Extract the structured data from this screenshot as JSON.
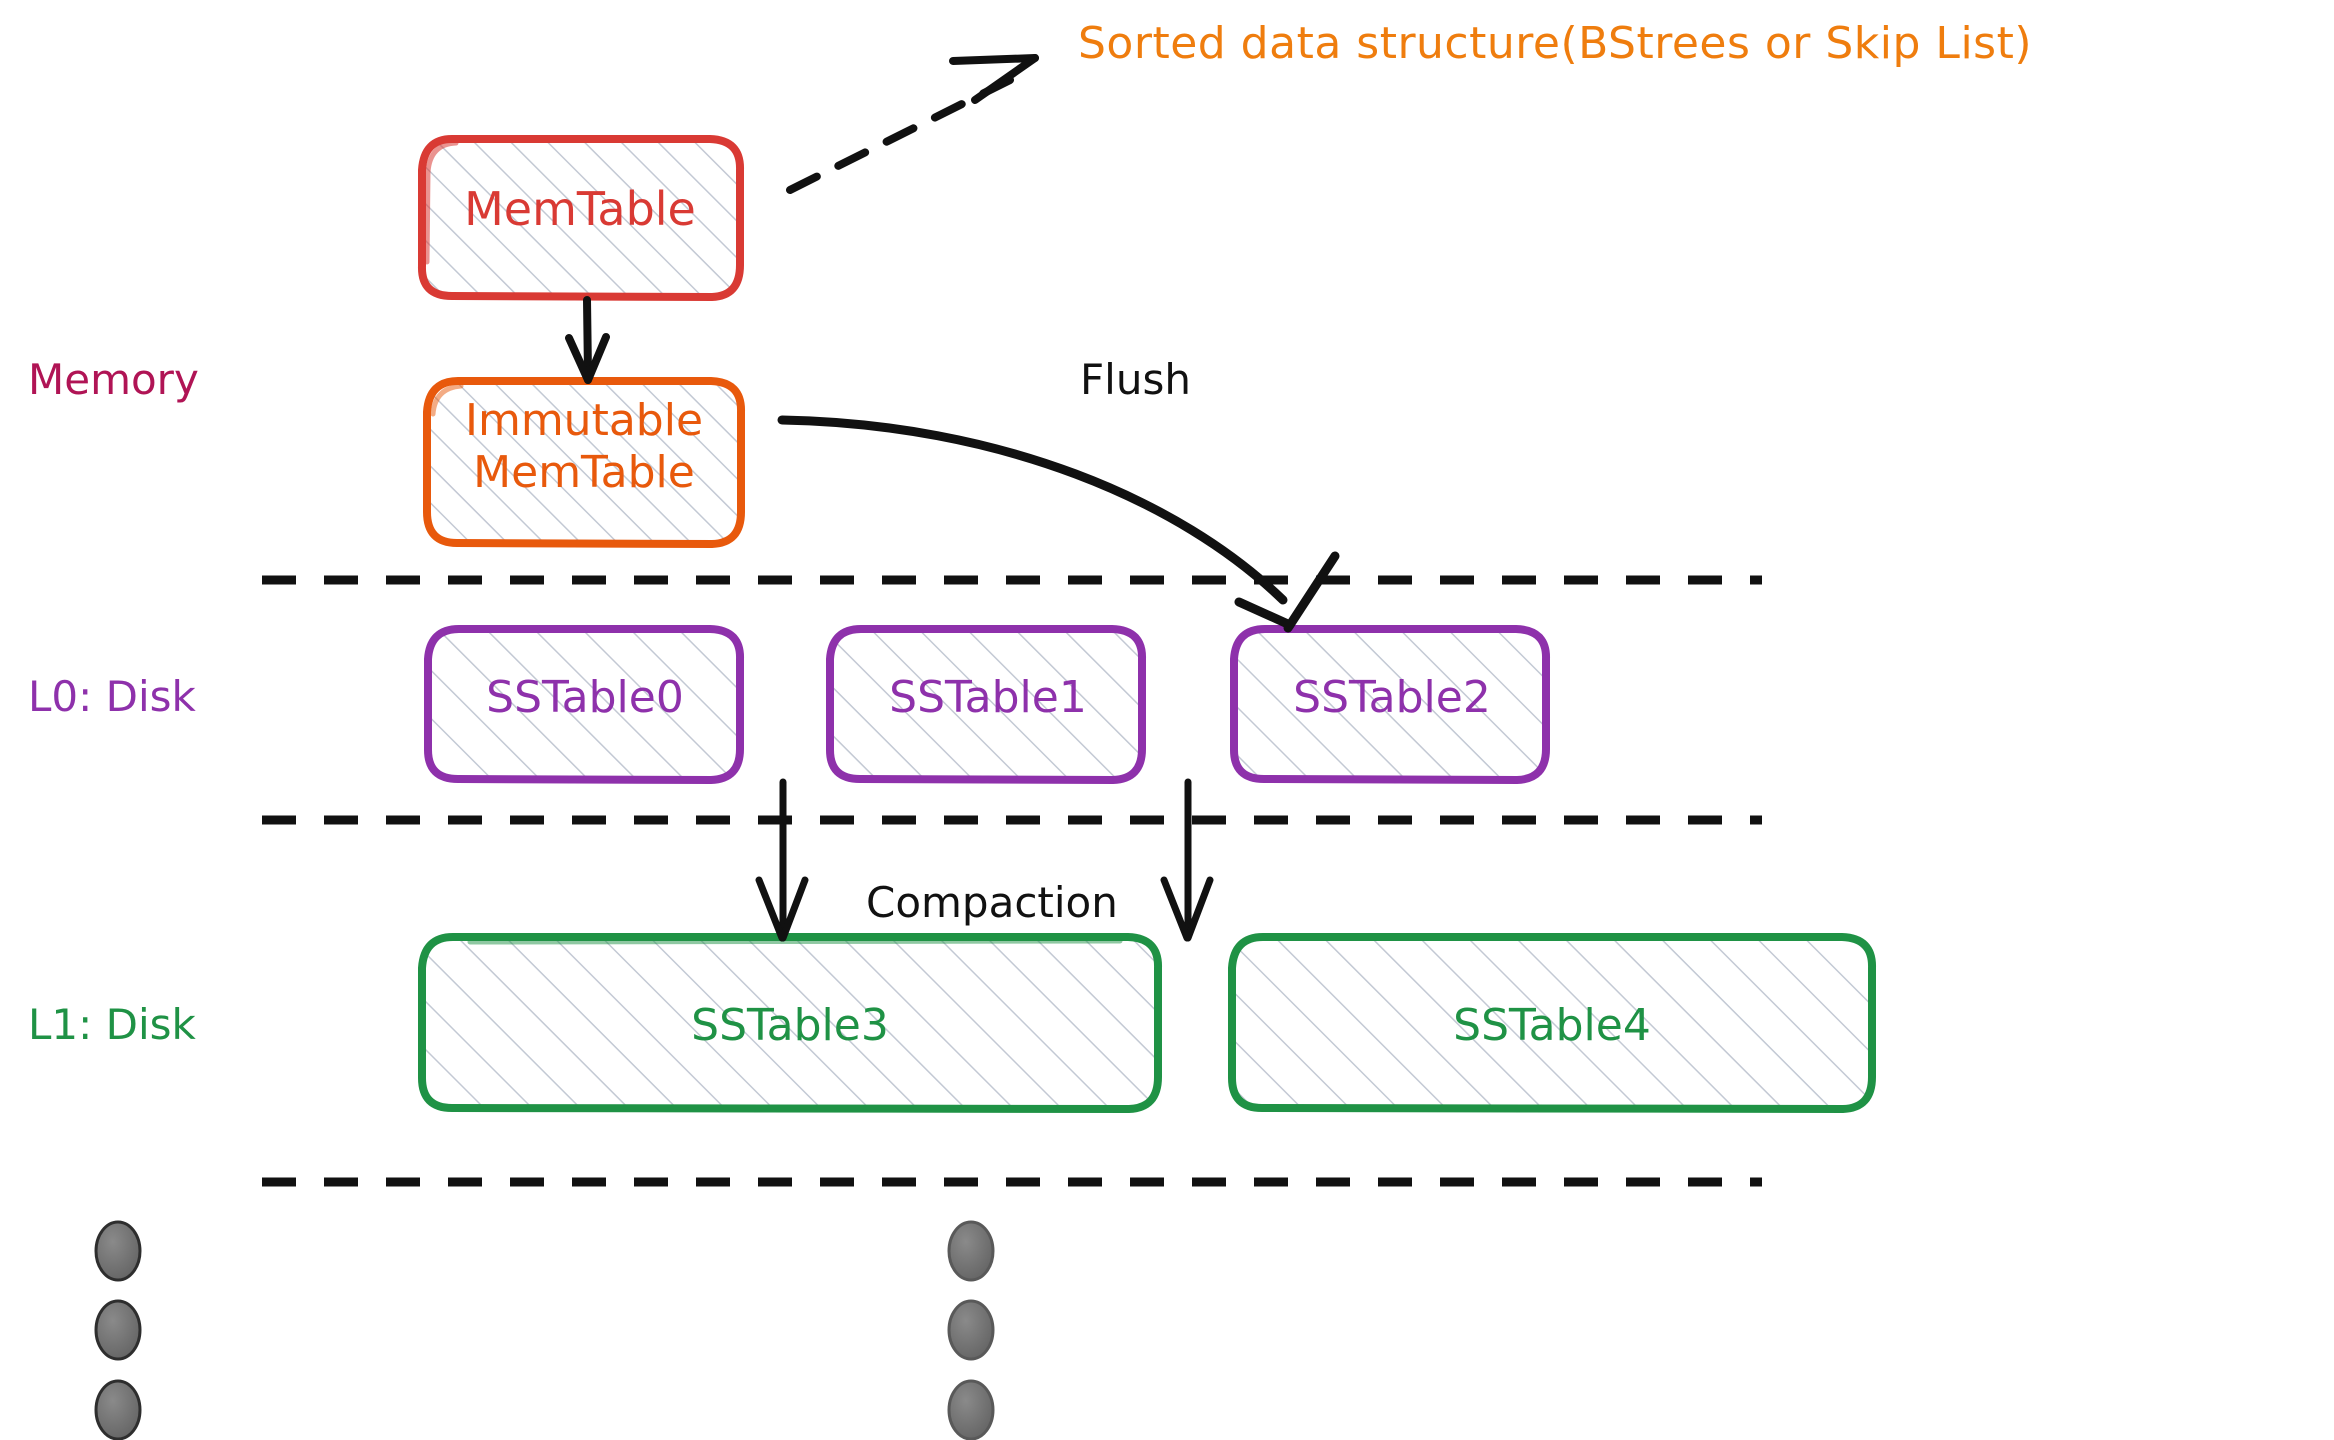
{
  "diagram": {
    "title_note": "Sorted data structure(BStrees or Skip List)",
    "tiers": [
      {
        "id": "memory",
        "label": "Memory",
        "color": "#b01455"
      },
      {
        "id": "l0",
        "label": "L0: Disk",
        "color": "#8e31ab"
      },
      {
        "id": "l1",
        "label": "L1: Disk",
        "color": "#1f9245"
      }
    ],
    "nodes": [
      {
        "id": "memtable",
        "label": "MemTable",
        "color": "#d93a34",
        "tier": "memory"
      },
      {
        "id": "immutable",
        "label": "Immutable\nMemTable",
        "color": "#e8590c",
        "tier": "memory"
      },
      {
        "id": "sstable0",
        "label": "SSTable0",
        "color": "#8e31ab",
        "tier": "l0"
      },
      {
        "id": "sstable1",
        "label": "SSTable1",
        "color": "#8e31ab",
        "tier": "l0"
      },
      {
        "id": "sstable2",
        "label": "SSTable2",
        "color": "#8e31ab",
        "tier": "l0"
      },
      {
        "id": "sstable3",
        "label": "SSTable3",
        "color": "#1f9245",
        "tier": "l1"
      },
      {
        "id": "sstable4",
        "label": "SSTable4",
        "color": "#1f9245",
        "tier": "l1"
      }
    ],
    "edges": [
      {
        "id": "memtable-to-immutable",
        "label": "",
        "from": "memtable",
        "to": "immutable",
        "style": "solid"
      },
      {
        "id": "flush",
        "label": "Flush",
        "from": "immutable",
        "to": "sstable2",
        "style": "curved"
      },
      {
        "id": "compaction-left",
        "label": "Compaction",
        "from": "sstable1",
        "to": "sstable3",
        "style": "solid"
      },
      {
        "id": "compaction-right",
        "label": "",
        "from": "sstable2",
        "to": "sstable3",
        "style": "solid"
      },
      {
        "id": "annotation",
        "label": "Sorted data structure(BStrees or Skip List)",
        "from": "memtable",
        "to": "note",
        "style": "dashed"
      }
    ],
    "dividers": 3,
    "ellipsis_dots": {
      "columns": 2,
      "dots_per_column": 3,
      "color": "#6f6f6f"
    },
    "colors": {
      "memtable": "#d93a34",
      "immutable": "#e8590c",
      "sstable_l0": "#8e31ab",
      "sstable_l1": "#1f9245",
      "memory_label": "#b01455",
      "note": "#ef7d0e",
      "arrow": "#111111",
      "hatch": "#c3c9d4",
      "dot": "#6f6f6f"
    }
  }
}
